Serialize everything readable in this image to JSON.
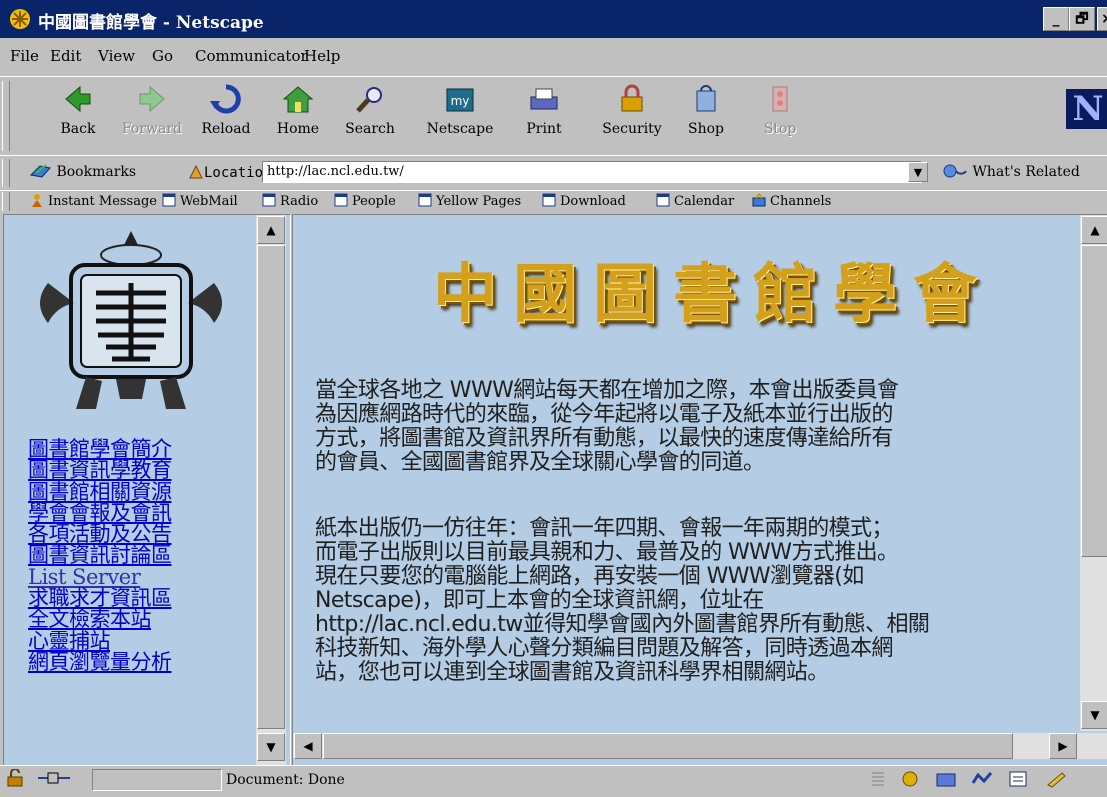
{
  "window": {
    "title": "中國圖書館學會 - Netscape",
    "controls": [
      "_",
      "🗗",
      "×"
    ]
  },
  "menu": [
    "File",
    "Edit",
    "View",
    "Go",
    "Communicator",
    "Help"
  ],
  "toolbar": {
    "buttons": [
      {
        "label": "Back",
        "icon": "back-arrow-icon",
        "enabled": true
      },
      {
        "label": "Forward",
        "icon": "forward-arrow-icon",
        "enabled": false
      },
      {
        "label": "Reload",
        "icon": "reload-icon",
        "enabled": true
      },
      {
        "label": "Home",
        "icon": "home-icon",
        "enabled": true
      },
      {
        "label": "Search",
        "icon": "search-icon",
        "enabled": true
      },
      {
        "label": "Netscape",
        "icon": "netscape-icon",
        "enabled": true
      },
      {
        "label": "Print",
        "icon": "print-icon",
        "enabled": true
      },
      {
        "label": "Security",
        "icon": "security-lock-icon",
        "enabled": true
      },
      {
        "label": "Shop",
        "icon": "shop-icon",
        "enabled": true
      },
      {
        "label": "Stop",
        "icon": "stop-icon",
        "enabled": false
      }
    ],
    "logo": "N"
  },
  "location_bar": {
    "bookmarks_label": "Bookmarks",
    "location_label": "Location:",
    "url": "http://lac.ncl.edu.tw/",
    "related_label": "What's Related"
  },
  "personal_toolbar": [
    "Instant Message",
    "WebMail",
    "Radio",
    "People",
    "Yellow Pages",
    "Download",
    "Calendar",
    "Channels"
  ],
  "left_nav": {
    "links": [
      {
        "text": "圖書館學會簡介",
        "visited": false
      },
      {
        "text": "圖書資訊學教育",
        "visited": false
      },
      {
        "text": "圖書館相關資源",
        "visited": false
      },
      {
        "text": "學會會報及會訊",
        "visited": false
      },
      {
        "text": "各項活動及公告",
        "visited": false
      },
      {
        "text": "圖書資訊討論區",
        "visited": false
      },
      {
        "text": "List Server",
        "visited": true
      },
      {
        "text": "求職求才資訊區",
        "visited": false
      },
      {
        "text": "全文檢索本站",
        "visited": false
      },
      {
        "text": "心靈捕站",
        "visited": false
      },
      {
        "text": "網頁瀏覽量分析",
        "visited": false
      }
    ]
  },
  "content": {
    "banner_chars": [
      "中",
      "國",
      "圖",
      "書",
      "館",
      "學",
      "會"
    ],
    "paragraph1_lines": [
      "當全球各地之 WWW網站每天都在增加之際，本會出版委員會",
      "為因應網路時代的來臨，從今年起將以電子及紙本並行出版的",
      "方式，將圖書館及資訊界所有動態，以最快的速度傳達給所有",
      "的會員、全國圖書館界及全球關心學會的同道。"
    ],
    "paragraph2_lines": [
      "紙本出版仍一仿往年：會訊一年四期、會報一年兩期的模式；",
      "而電子出版則以目前最具親和力、最普及的 WWW方式推出。",
      "現在只要您的電腦能上網路，再安裝一個 WWW瀏覽器(如",
      "Netscape)，即可上本會的全球資訊網，位址在",
      "http://lac.ncl.edu.tw並得知學會國內外圖書館界所有動態、相關",
      "科技新知、海外學人心聲分類編目問題及解答，同時透過本網",
      "站，您也可以連到全球圖書館及資訊科學界相關網站。"
    ]
  },
  "status_bar": {
    "text": "Document: Done"
  },
  "colors": {
    "titlebar": "#0a246a",
    "frame_bg": "#b4cde4",
    "link": "#0000d0",
    "banner_gold": "#d4a01c"
  }
}
